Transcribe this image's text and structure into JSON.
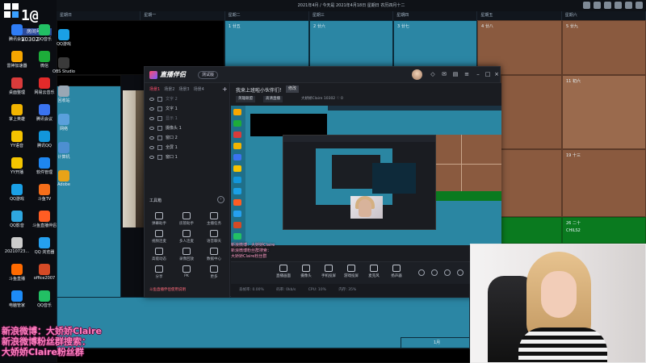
{
  "calendar": {
    "header": "2021年4月 / 今天是 2021年4月18日 星期日 农历四月十二",
    "weekdays": [
      "星期日",
      "星期一",
      "星期二",
      "星期三",
      "星期四",
      "星期五",
      "星期六"
    ],
    "cells": [
      {
        "num": "1 廿五"
      },
      {
        "num": "2 廿六"
      },
      {
        "num": "3 廿七"
      },
      {
        "num": "4 廿八"
      },
      {
        "num": "5 廿九"
      },
      {
        "num": "11 初六"
      },
      {
        "num": "19 十三"
      },
      {
        "num": "26 二十"
      },
      {
        "num": "1月"
      }
    ],
    "bottom_label": "CHILS2"
  },
  "logo": {
    "big_text": "1@",
    "room_label": "房间号",
    "room_number": "10302"
  },
  "desktop_icons": [
    {
      "label": "腾讯会议",
      "color": "#2f7df6"
    },
    {
      "label": "QQ音乐",
      "color": "#22c064"
    },
    {
      "label": "雷神加速器",
      "color": "#f7a600"
    },
    {
      "label": "微信",
      "color": "#1dad3a"
    },
    {
      "label": "桌面整理",
      "color": "#d93b3b"
    },
    {
      "label": "网易云音乐",
      "color": "#e22a2a"
    },
    {
      "label": "掌上英雄",
      "color": "#f2b400"
    },
    {
      "label": "腾讯会议",
      "color": "#3a73f0"
    },
    {
      "label": "YY语音",
      "color": "#f5c300"
    },
    {
      "label": "腾讯QQ",
      "color": "#1296db"
    },
    {
      "label": "YY开播",
      "color": "#f4c500"
    },
    {
      "label": "软件管理",
      "color": "#1e86f0"
    },
    {
      "label": "QQ游戏",
      "color": "#1aa0e6"
    },
    {
      "label": "斗鱼TV",
      "color": "#f56e1a"
    },
    {
      "label": "QQ影音",
      "color": "#2ea7e0"
    },
    {
      "label": "斗鱼直播伴侣",
      "color": "#ff5d23"
    },
    {
      "label": "20210723...",
      "color": "#cccccc"
    },
    {
      "label": "QQ 浏览器",
      "color": "#25a0ef"
    },
    {
      "label": "斗鱼直播",
      "color": "#ff6a00"
    },
    {
      "label": "office2007",
      "color": "#d44a26"
    },
    {
      "label": "电脑管家",
      "color": "#1d8cf8"
    },
    {
      "label": "QQ音乐",
      "color": "#22c064"
    },
    {
      "label": "QQ游戏",
      "color": "#1aa0e6"
    },
    {
      "label": "OBS Studio",
      "color": "#3a3a3a"
    },
    {
      "label": "回收站",
      "color": "#9aa7b4"
    },
    {
      "label": "网络",
      "color": "#5aa0dc"
    },
    {
      "label": "计算机",
      "color": "#4d8fd1"
    },
    {
      "label": "Adobe",
      "color": "#e8a317"
    }
  ],
  "app": {
    "name": "直播伴侣",
    "tag": "测试版",
    "sidebar": {
      "tabs": [
        "场景1",
        "场景2",
        "场景3",
        "场景4"
      ],
      "active_tab": 0,
      "layers": [
        {
          "name": "文字 2",
          "dim": true
        },
        {
          "name": "文字 1",
          "dim": false
        },
        {
          "name": "显示 1",
          "dim": true
        },
        {
          "name": "摄像头 1",
          "dim": false
        },
        {
          "name": "窗口 2",
          "dim": false
        },
        {
          "name": "全屏 1",
          "dim": false
        },
        {
          "name": "窗口 1",
          "dim": false
        }
      ],
      "tools_title": "工具箱",
      "tools": [
        {
          "label": "弹幕助手"
        },
        {
          "label": "房管助手"
        },
        {
          "label": "主播任务"
        },
        {
          "label": "视频连麦"
        },
        {
          "label": "多人连麦"
        },
        {
          "label": "语音聊天"
        },
        {
          "label": "高能动态"
        },
        {
          "label": "录像回放"
        },
        {
          "label": "数据中心"
        },
        {
          "label": "分享"
        },
        {
          "label": "PK"
        },
        {
          "label": "更多"
        }
      ],
      "footer": "斗鱼直播伴侣使用说明"
    },
    "main": {
      "title": "我来上班啦小伙伴们！",
      "badge": "修改",
      "chips": [
        "英雄联盟",
        "高清直播"
      ],
      "meta": "大娇娇Claire  10302  ♡ 0",
      "overlay_text": [
        "新浪微博：大娇娇Claire",
        "新浪微博粉丝群搜索：",
        "大娇娇Claire粉丝群"
      ],
      "bottom_buttons": [
        "直播画面",
        "摄像头",
        "手机投屏",
        "游戏投屏",
        "麦克风",
        "扬声器"
      ],
      "status": [
        "丢帧率: 0.00%",
        "码率: 0kb/s",
        "CPU: 10%",
        "内存: 35%"
      ]
    }
  },
  "captions": [
    "新浪微博：大娇娇Claire",
    "新浪微博粉丝群搜索：",
    "大娇娇Claire粉丝群"
  ]
}
